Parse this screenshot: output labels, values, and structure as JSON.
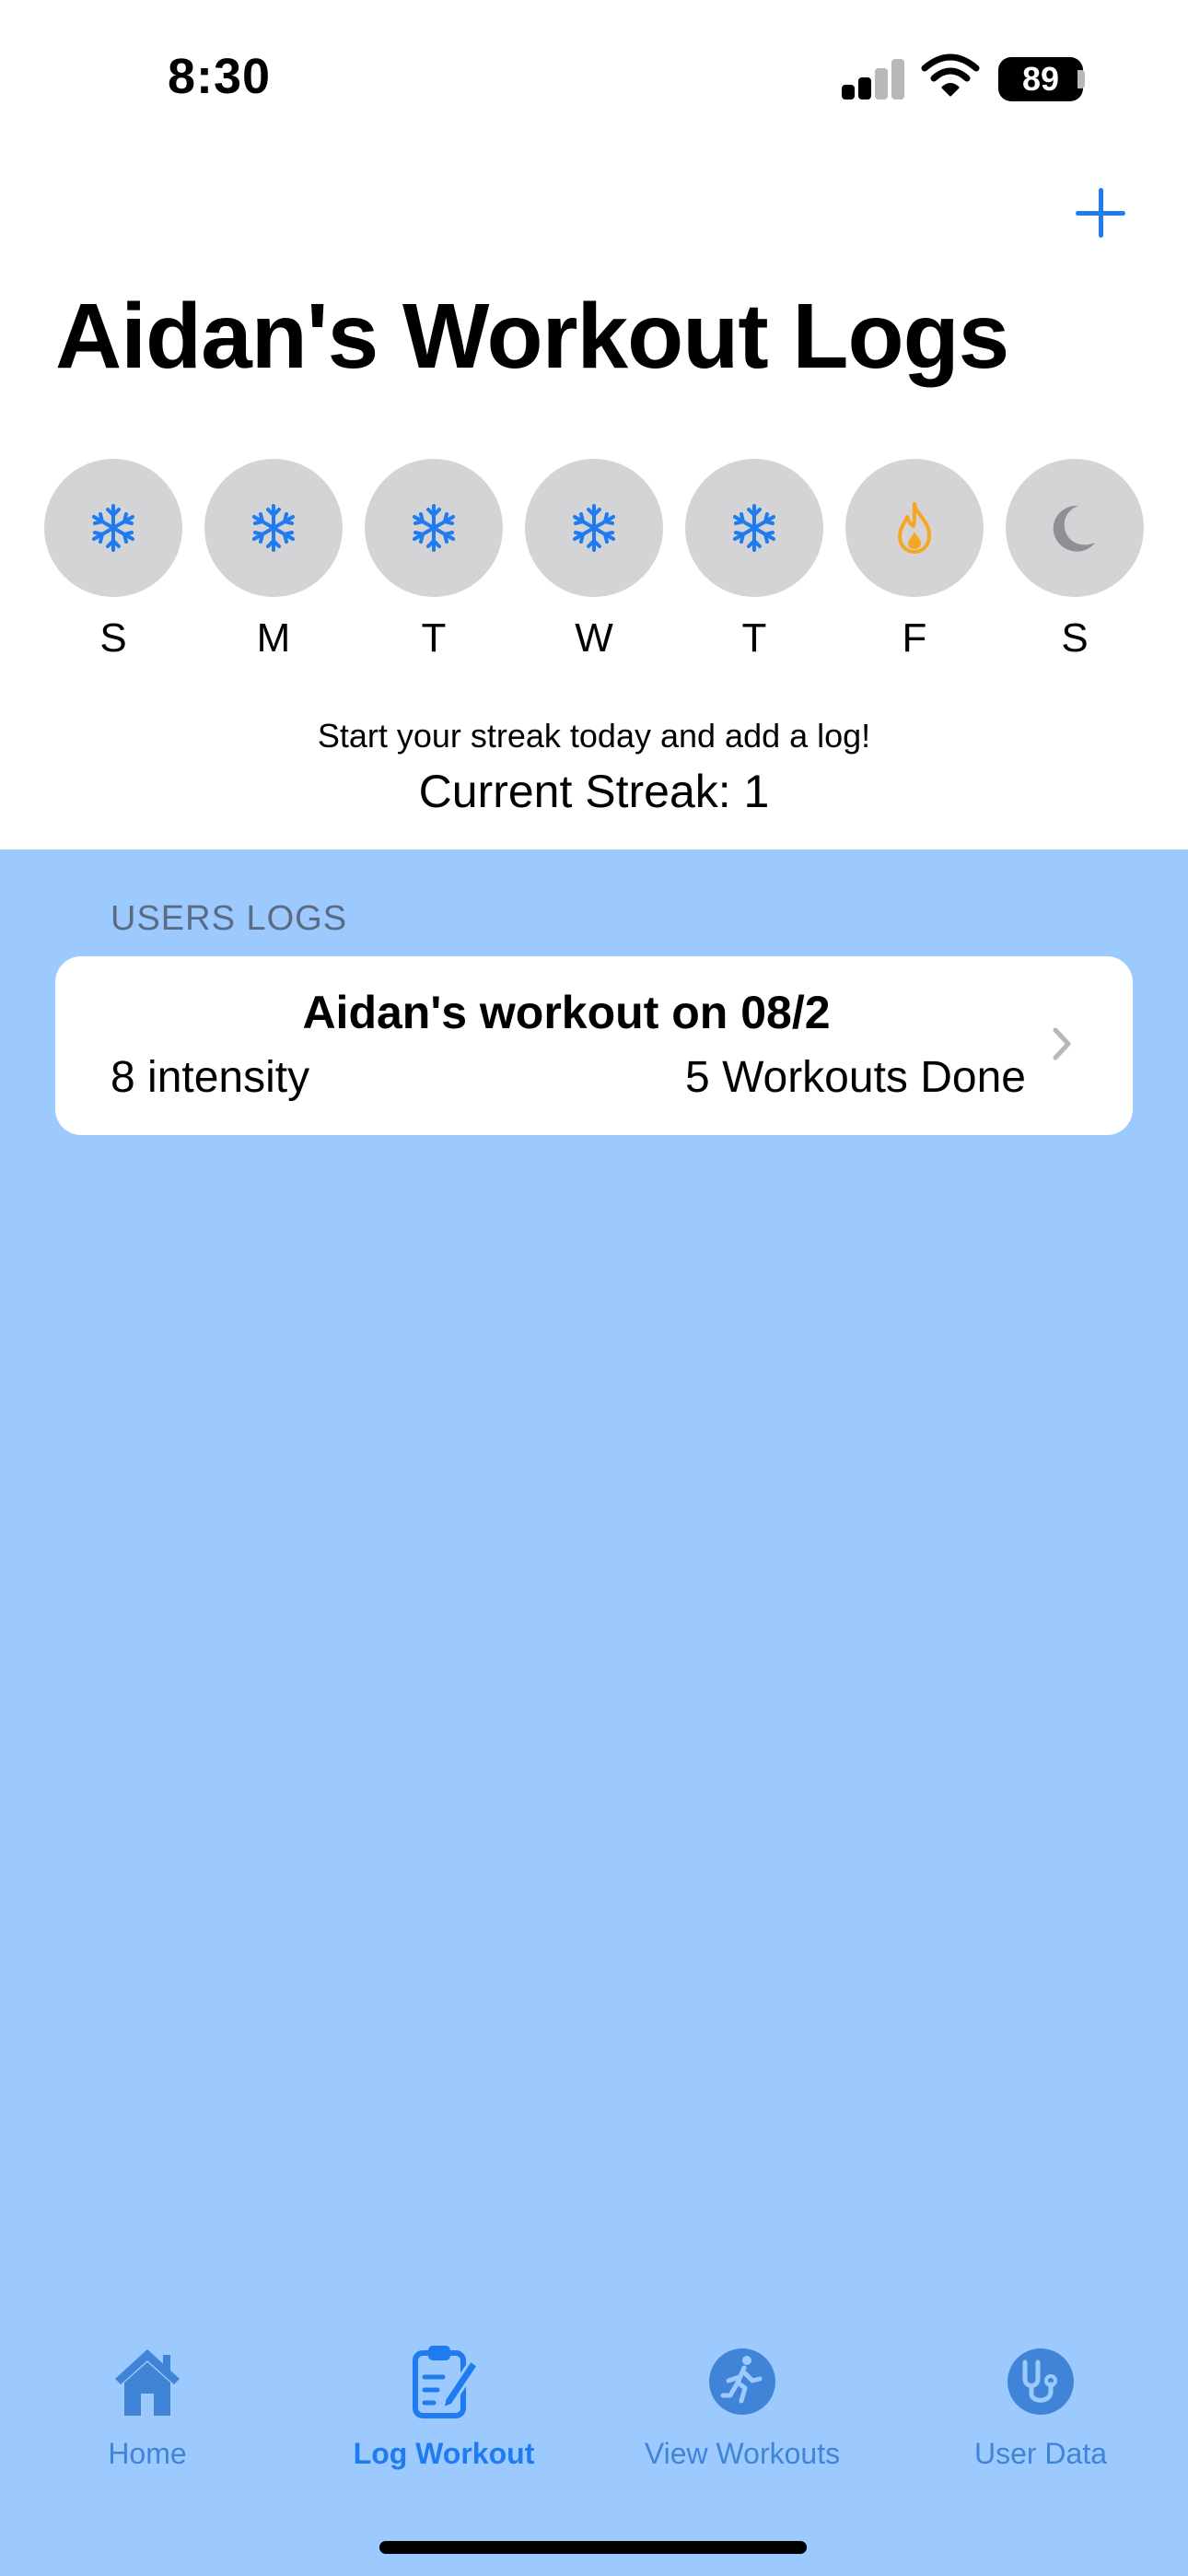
{
  "status_bar": {
    "time": "8:30",
    "battery": "89"
  },
  "header": {
    "title": "Aidan's Workout Logs",
    "add_icon": "plus-icon"
  },
  "week": [
    {
      "letter": "S",
      "icon": "snowflake-icon"
    },
    {
      "letter": "M",
      "icon": "snowflake-icon"
    },
    {
      "letter": "T",
      "icon": "snowflake-icon"
    },
    {
      "letter": "W",
      "icon": "snowflake-icon"
    },
    {
      "letter": "T",
      "icon": "snowflake-icon"
    },
    {
      "letter": "F",
      "icon": "flame-icon"
    },
    {
      "letter": "S",
      "icon": "moon-icon"
    }
  ],
  "streak": {
    "message": "Start your streak today and add a log!",
    "current": "Current Streak: 1"
  },
  "logs": {
    "section_title": "USERS LOGS",
    "items": [
      {
        "title": "Aidan's workout on 08/2",
        "intensity": "8 intensity",
        "workouts": "5 Workouts Done"
      }
    ]
  },
  "tabs": [
    {
      "label": "Home",
      "icon": "house-icon"
    },
    {
      "label": "Log Workout",
      "icon": "clipboard-icon",
      "active": true
    },
    {
      "label": "View Workouts",
      "icon": "runner-icon"
    },
    {
      "label": "User Data",
      "icon": "stethoscope-icon"
    }
  ],
  "colors": {
    "accent": "#1e7cf0",
    "logs_background": "#9ccaff",
    "day_circle": "#d4d4d6",
    "flame": "#f5a623",
    "moon": "#8e8e93"
  }
}
